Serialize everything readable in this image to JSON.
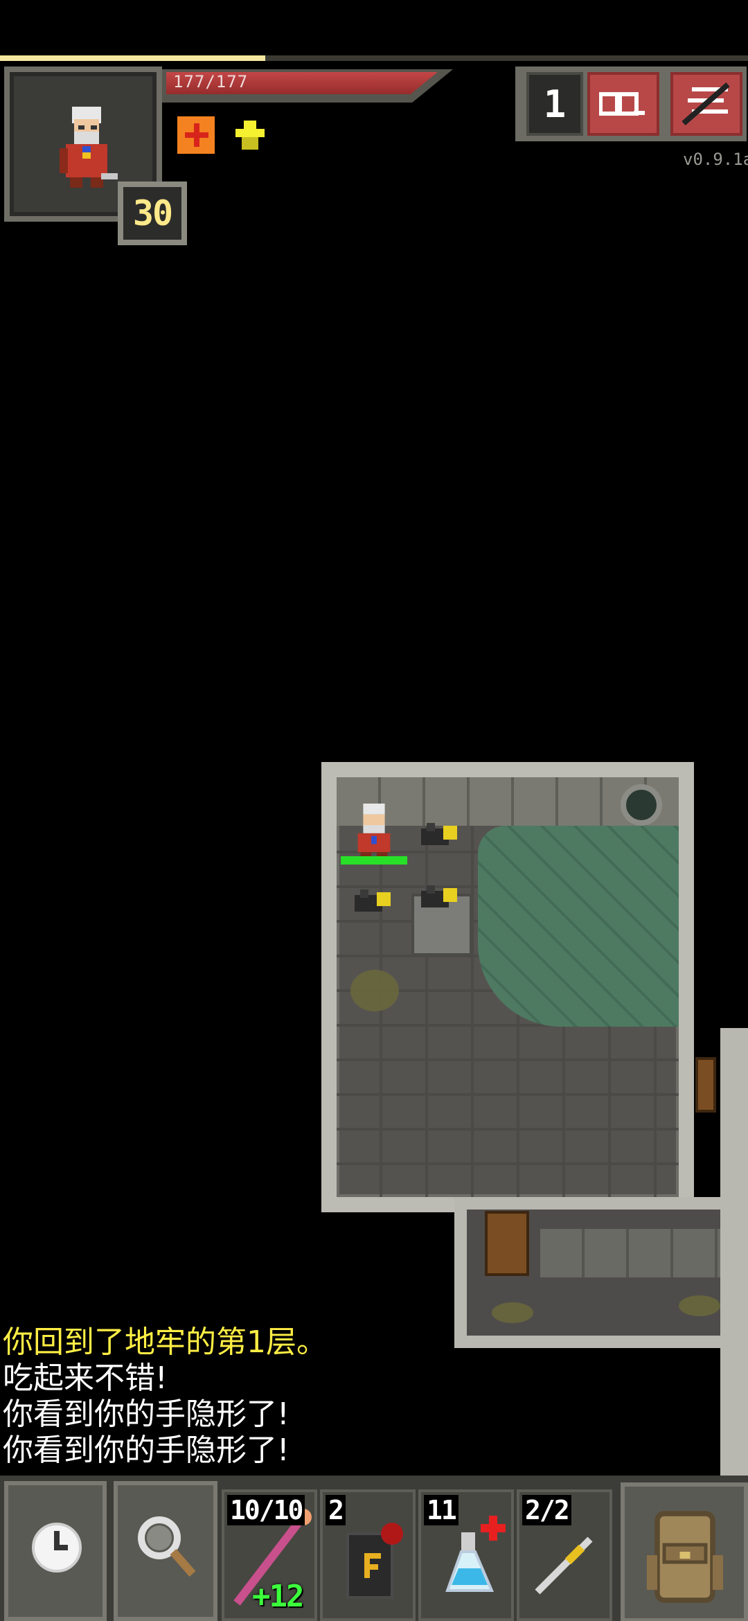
{
  "hud": {
    "experience_progress": 0.355,
    "hp_text": "177/177",
    "hero_level": "30",
    "buffs": [
      "health-regen-buff-icon",
      "level-up-buff-icon"
    ],
    "depth": "1",
    "version": "v0.9.1a",
    "journal_icon": "journal-icon",
    "menu_icon": "menu-icon"
  },
  "game_log": [
    {
      "text": "你回到了地牢的第1层。",
      "color": "#ffee44"
    },
    {
      "text": "吃起来不错!",
      "color": "#ffffff"
    },
    {
      "text": "你看到你的手隐形了!",
      "color": "#ffffff"
    },
    {
      "text": "你看到你的手隐形了!",
      "color": "#ffffff"
    }
  ],
  "toolbar": {
    "wait_icon": "clock-icon",
    "search_icon": "magnifier-icon",
    "quickslots": [
      {
        "item": "wand-icon",
        "count": "10/10",
        "bonus": "+12"
      },
      {
        "item": "tome-icon",
        "count": "2",
        "bonus": ""
      },
      {
        "item": "potion-icon",
        "count": "11",
        "bonus": ""
      },
      {
        "item": "darts-icon",
        "count": "2/2",
        "bonus": ""
      }
    ],
    "backpack_icon": "backpack-icon"
  },
  "colors": {
    "hp_bar": "#c44646",
    "log_highlight": "#ffee44",
    "hero_health_bar": "#28e028",
    "water": "#4e7a62",
    "wall": "#bcbcb4"
  }
}
